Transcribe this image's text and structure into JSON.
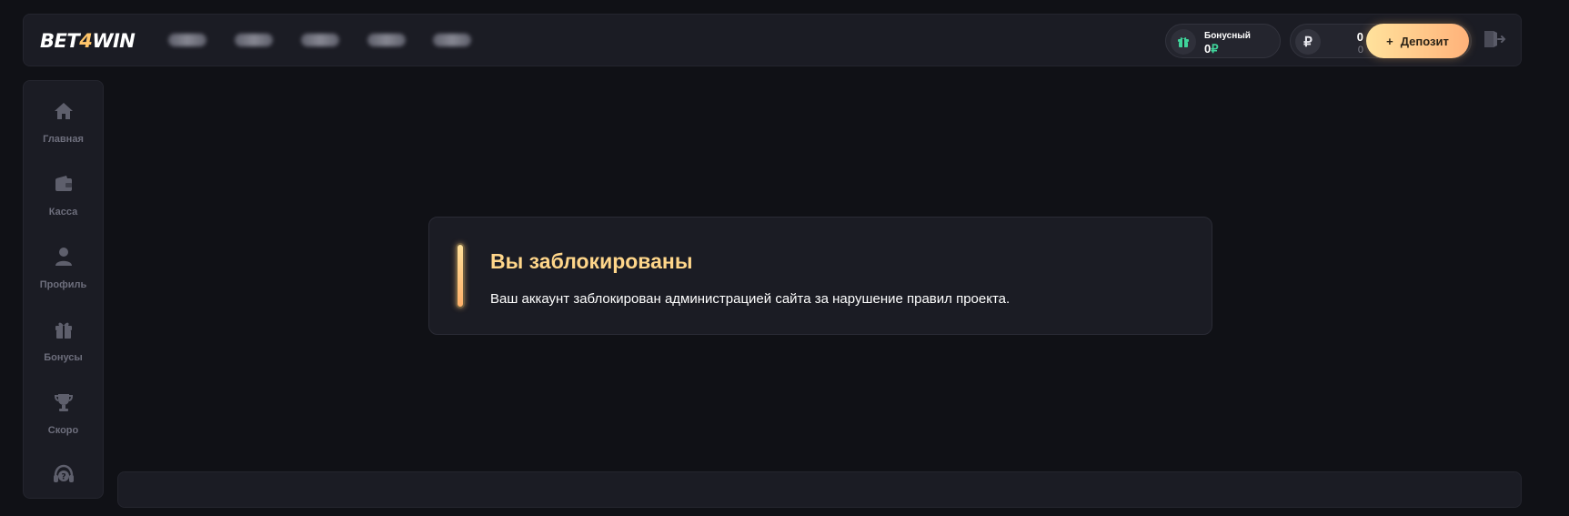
{
  "header": {
    "logo_pre": "BET",
    "logo_four": "4",
    "logo_post": "WIN",
    "bonus": {
      "label": "Бонусный",
      "amount": "0",
      "currency": "₽"
    },
    "balance": {
      "currency_symbol": "₽",
      "main": "0",
      "sub": "0"
    },
    "deposit": {
      "plus": "+",
      "label": "Депозит"
    }
  },
  "sidebar": {
    "items": [
      {
        "label": "Главная",
        "icon": "home-icon"
      },
      {
        "label": "Касса",
        "icon": "wallet-icon"
      },
      {
        "label": "Профиль",
        "icon": "user-icon"
      },
      {
        "label": "Бонусы",
        "icon": "gift-icon"
      },
      {
        "label": "Скоро",
        "icon": "trophy-icon"
      },
      {
        "label": "",
        "icon": "support-icon"
      }
    ]
  },
  "alert": {
    "title": "Вы заблокированы",
    "message": "Ваш аккаунт заблокирован администрацией сайта за нарушение правил проекта."
  },
  "colors": {
    "background": "#101116",
    "panel": "#1b1c24",
    "accent": "#ffd68a",
    "bonus_currency": "#3fd39a",
    "muted": "#6d6e7c"
  }
}
